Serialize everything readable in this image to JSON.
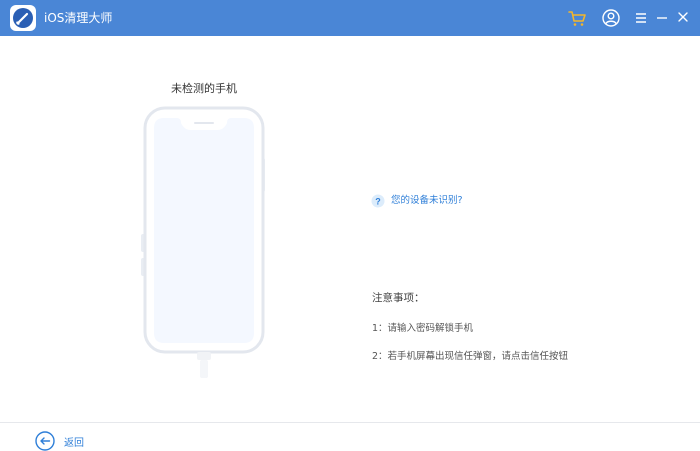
{
  "window": {
    "title": "iOS清理大师"
  },
  "main": {
    "phone_caption": "未检测的手机",
    "help_link": "您的设备未识别?",
    "notes_title": "注意事项：",
    "notes": [
      "1：请输入密码解锁手机",
      "2：若手机屏幕出现信任弹窗，请点击信任按钮"
    ]
  },
  "footer": {
    "back_label": "返回"
  },
  "colors": {
    "titlebar": "#4a86d6",
    "cart_icon": "#f3b62b",
    "link": "#2f7fd8",
    "phone_screen": "#f4f8ff"
  },
  "icons": {
    "logo": "broom-logo-icon",
    "cart": "cart-icon",
    "user": "user-icon",
    "menu": "menu-icon",
    "minimize": "minimize-icon",
    "close": "close-icon",
    "help": "question-icon",
    "back": "back-arrow-icon"
  }
}
